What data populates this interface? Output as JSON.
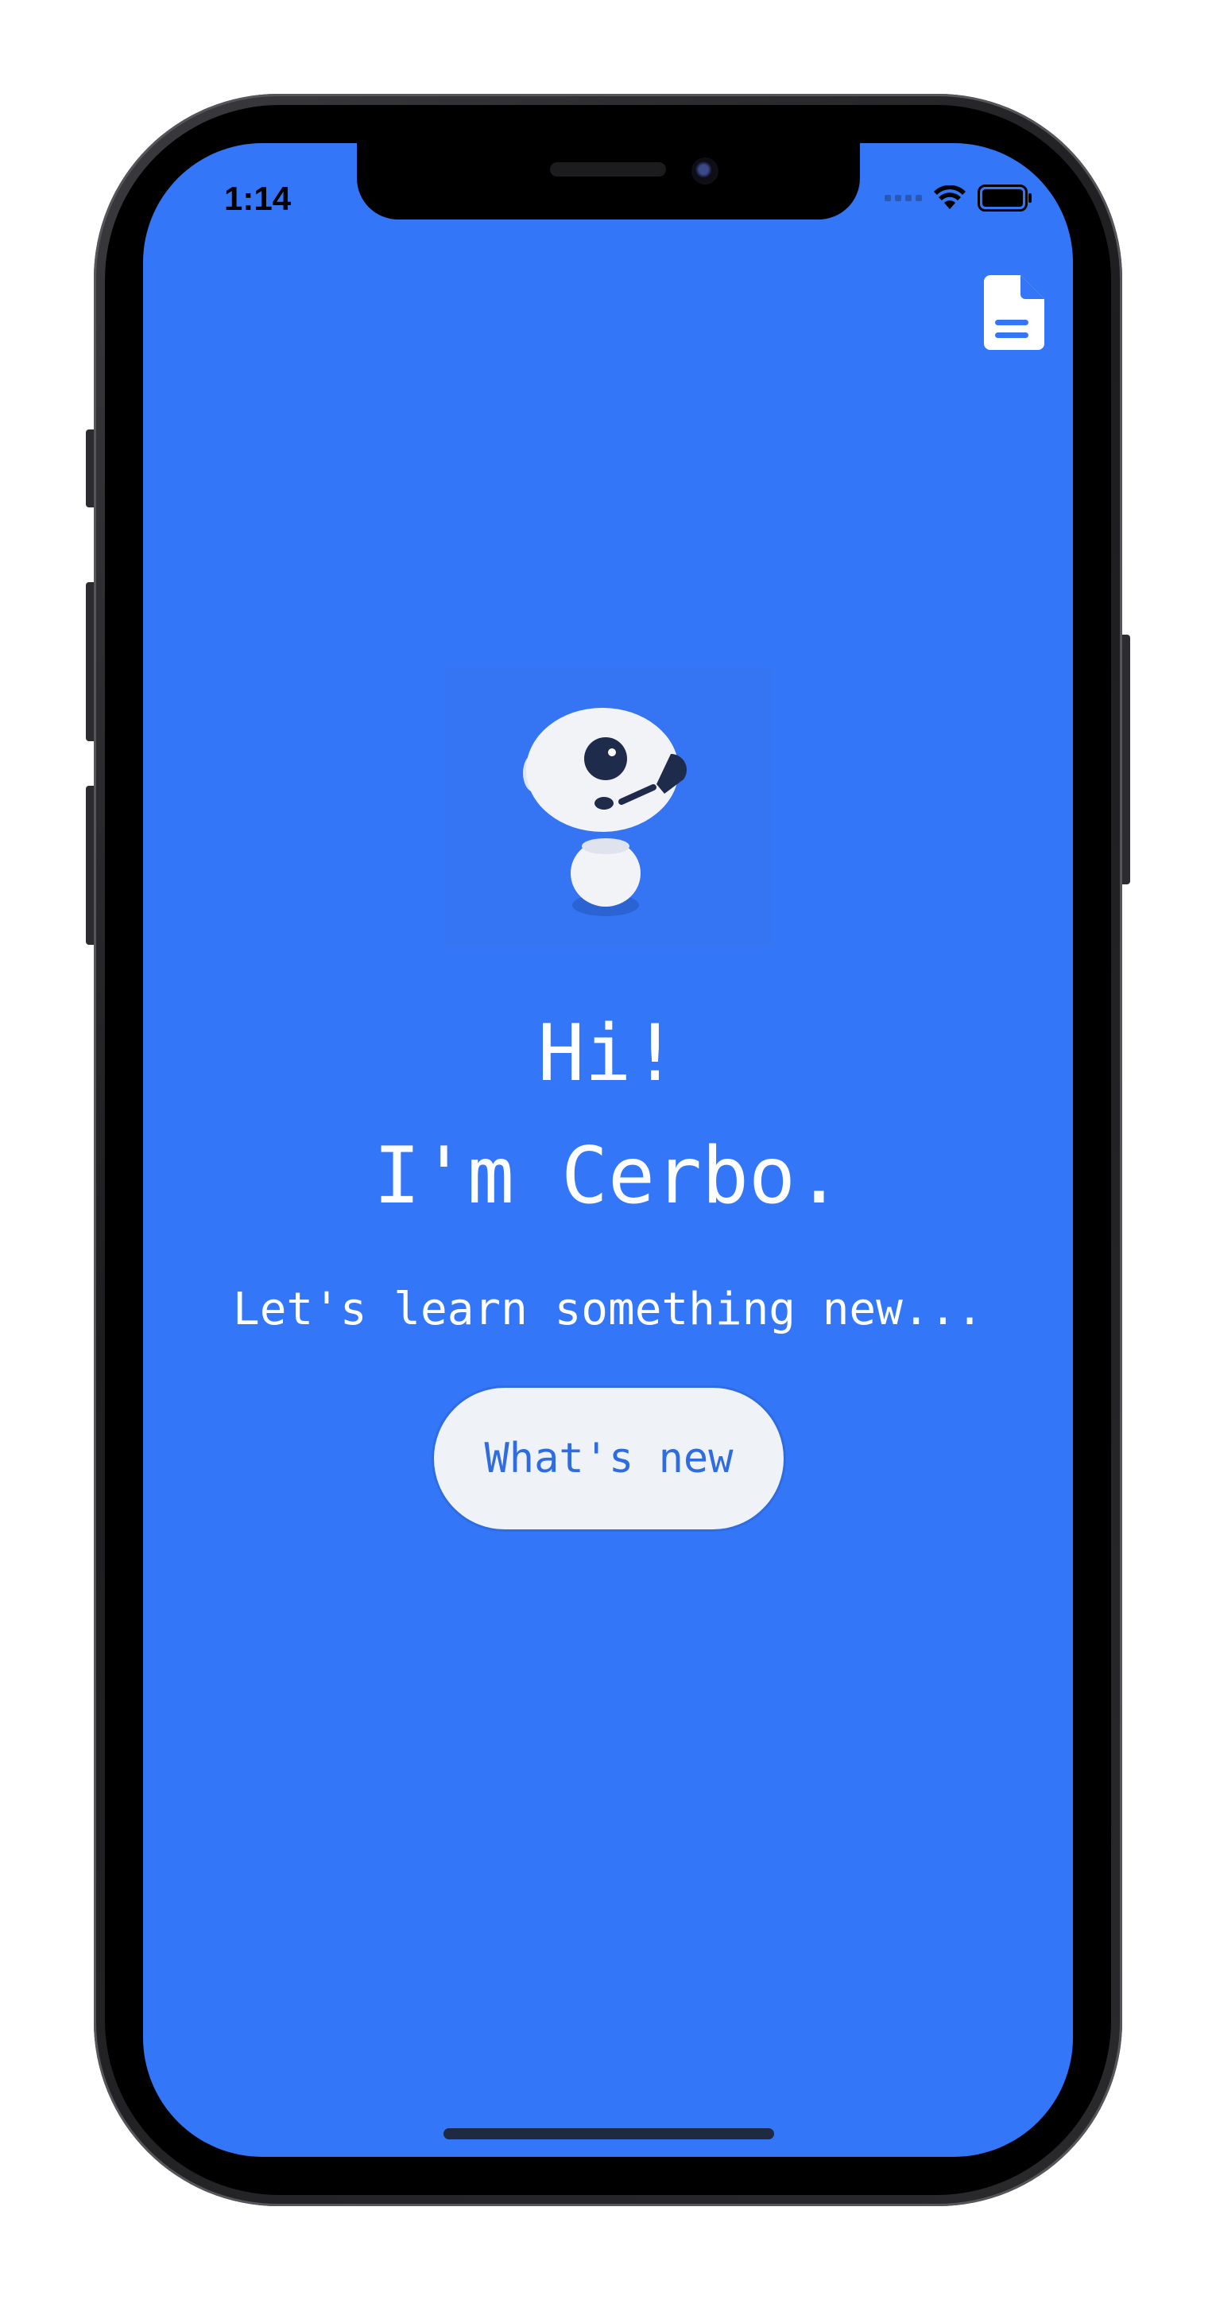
{
  "status_bar": {
    "time": "1:14"
  },
  "header": {
    "doc_icon": "document-icon"
  },
  "hero": {
    "image_icon": "robot-mascot-icon"
  },
  "greeting": {
    "line1": "Hi!",
    "line2": "I'm Cerbo."
  },
  "tagline": "Let's learn something new...",
  "cta": {
    "label": "What's new"
  },
  "colors": {
    "background": "#3377f8",
    "button_bg": "#eff2f7",
    "button_text": "#2f6ce0",
    "text": "#ffffff"
  }
}
